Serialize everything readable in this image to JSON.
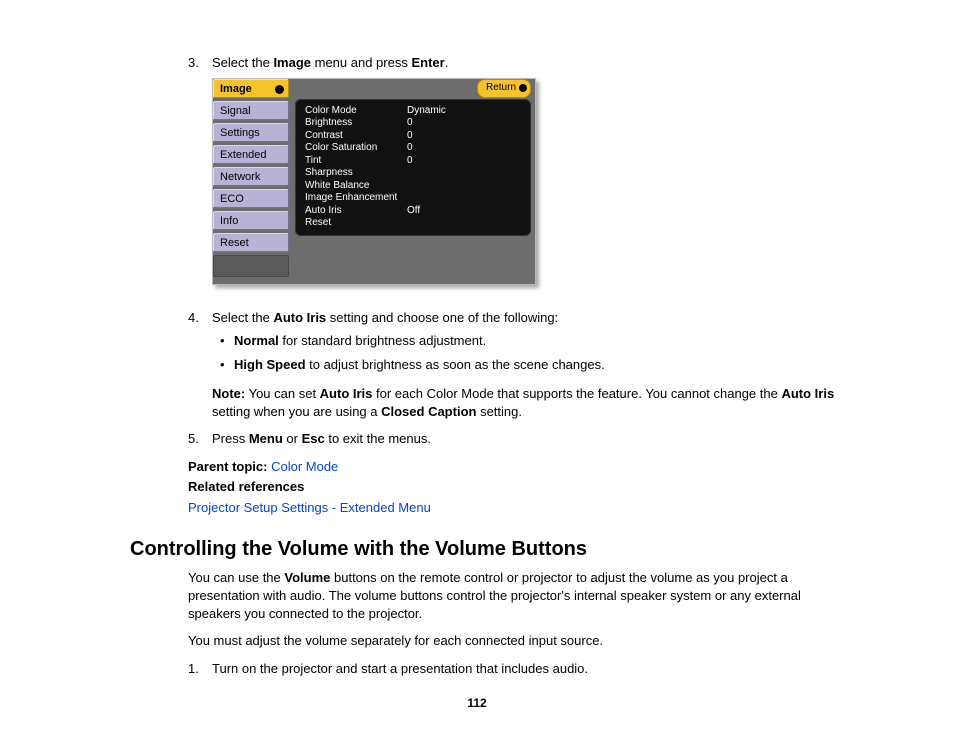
{
  "steps_a": {
    "s3": {
      "num": "3.",
      "text_before": "Select the ",
      "bold1": "Image",
      "text_mid": " menu and press ",
      "bold2": "Enter",
      "text_after": "."
    },
    "s4": {
      "num": "4.",
      "text_before": "Select the ",
      "bold1": "Auto Iris",
      "text_after": " setting and choose one of the following:",
      "bullets": [
        {
          "bold": "Normal",
          "rest": " for standard brightness adjustment."
        },
        {
          "bold": "High Speed",
          "rest": " to adjust brightness as soon as the scene changes."
        }
      ],
      "note": {
        "label": "Note:",
        "t1": " You can set ",
        "b1": "Auto Iris",
        "t2": " for each Color Mode that supports the feature. You cannot change the ",
        "b2": "Auto Iris",
        "t3": " setting when you are using a ",
        "b3": "Closed Caption",
        "t4": " setting."
      }
    },
    "s5": {
      "num": "5.",
      "t1": "Press ",
      "b1": "Menu",
      "t2": " or ",
      "b2": "Esc",
      "t3": " to exit the menus."
    }
  },
  "parent_topic": {
    "label": "Parent topic:",
    "link": "Color Mode"
  },
  "related": {
    "label": "Related references",
    "link": "Projector Setup Settings - Extended Menu"
  },
  "section_title": "Controlling the Volume with the Volume Buttons",
  "para1": {
    "t1": "You can use the ",
    "b1": "Volume",
    "t2": " buttons on the remote control or projector to adjust the volume as you project a presentation with audio. The volume buttons control the projector's internal speaker system or any external speakers you connected to the projector."
  },
  "para2": "You must adjust the volume separately for each connected input source.",
  "steps_b": {
    "s1": {
      "num": "1.",
      "text": "Turn on the projector and start a presentation that includes audio."
    }
  },
  "page_number": "112",
  "menu": {
    "tabs": [
      "Image",
      "Signal",
      "Settings",
      "Extended",
      "Network",
      "ECO",
      "Info",
      "Reset"
    ],
    "return": "Return",
    "rows": [
      {
        "k": "Color Mode",
        "v": "Dynamic"
      },
      {
        "k": "Brightness",
        "v": "0"
      },
      {
        "k": "Contrast",
        "v": "0"
      },
      {
        "k": "Color Saturation",
        "v": "0"
      },
      {
        "k": "Tint",
        "v": "0"
      },
      {
        "k": "Sharpness",
        "v": ""
      },
      {
        "k": "White Balance",
        "v": ""
      },
      {
        "k": "Image Enhancement",
        "v": ""
      },
      {
        "k": "Auto Iris",
        "v": "Off"
      },
      {
        "k": "Reset",
        "v": ""
      }
    ]
  }
}
